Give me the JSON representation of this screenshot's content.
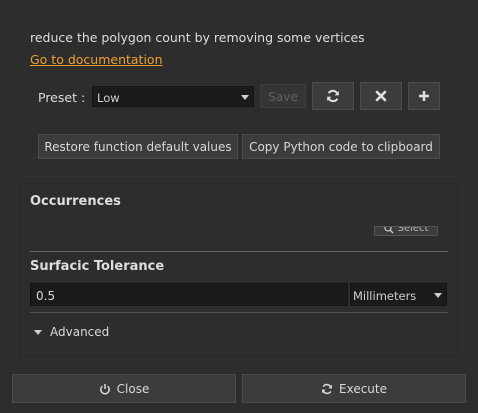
{
  "description": "reduce the polygon count by removing some vertices",
  "documentation_link": "Go to documentation",
  "preset": {
    "label": "Preset :",
    "selected": "Low",
    "save_label": "Save"
  },
  "actions": {
    "restore_label": "Restore function default values",
    "copy_label": "Copy Python code to clipboard"
  },
  "occurrences": {
    "title": "Occurrences",
    "select_label": "Select"
  },
  "surfacic_tolerance": {
    "title": "Surfacic Tolerance",
    "value": "0.5",
    "unit": "Millimeters"
  },
  "advanced_label": "Advanced",
  "footer": {
    "close_label": "Close",
    "execute_label": "Execute"
  },
  "colors": {
    "background": "#2d2d2d",
    "link": "#f0a030",
    "input_bg": "#1b1b1b"
  }
}
